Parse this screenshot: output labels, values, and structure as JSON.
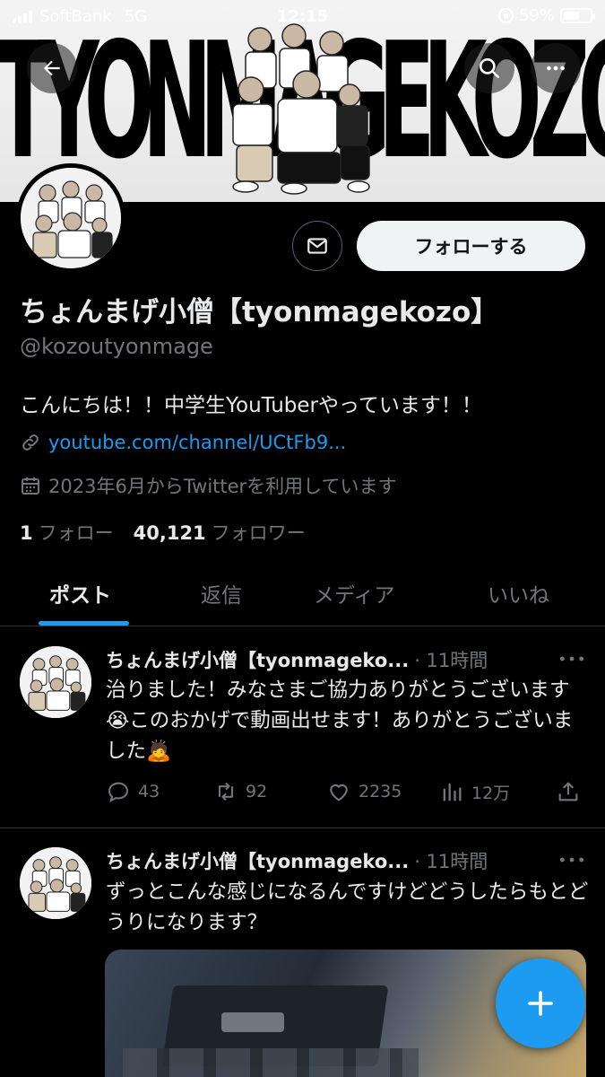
{
  "status_bar": {
    "carrier": "SoftBank",
    "network": "5G",
    "time": "12:15",
    "battery_percent": "59%",
    "battery_level": 0.59
  },
  "banner": {
    "text": "TYONMAGEKOZO"
  },
  "profile": {
    "follow_label": "フォローする",
    "name": "ちょんまげ小僧【tyonmagekozo】",
    "handle": "@kozoutyonmage",
    "bio": "こんにちは！！中学生YouTuberやっています！！",
    "link": "youtube.com/channel/UCtFb9...",
    "joined": "2023年6月からTwitterを利用しています",
    "following_count": "1",
    "following_label": "フォロー",
    "followers_count": "40,121",
    "followers_label": "フォロワー"
  },
  "tabs": [
    {
      "label": "ポスト",
      "active": true
    },
    {
      "label": "返信",
      "active": false
    },
    {
      "label": "メディア",
      "active": false
    },
    {
      "label": "いいね",
      "active": false
    }
  ],
  "posts": [
    {
      "author": "ちょんまげ小僧【tyonmageko...",
      "time": "· 11時間",
      "text": "治りました！みなさまご協力ありがとうございます😭このおかげで動画出せます！ありがとうございました🙇",
      "replies": "43",
      "reposts": "92",
      "likes": "2235",
      "views": "12万"
    },
    {
      "author": "ちょんまげ小僧【tyonmageko...",
      "time": "· 11時間",
      "text": "ずっとこんな感じになるんですけどどうしたらもとどうりになります？"
    }
  ],
  "icons": {
    "back": "arrow-left-icon",
    "search": "search-icon",
    "more": "more-horizontal-icon",
    "message": "envelope-icon",
    "link": "link-icon",
    "calendar": "calendar-icon",
    "reply": "reply-icon",
    "repost": "repost-icon",
    "like": "heart-icon",
    "views": "analytics-icon",
    "share": "share-icon",
    "compose": "plus-icon"
  },
  "colors": {
    "accent": "#1d9bf0",
    "background": "#000000",
    "muted": "#71767b"
  }
}
